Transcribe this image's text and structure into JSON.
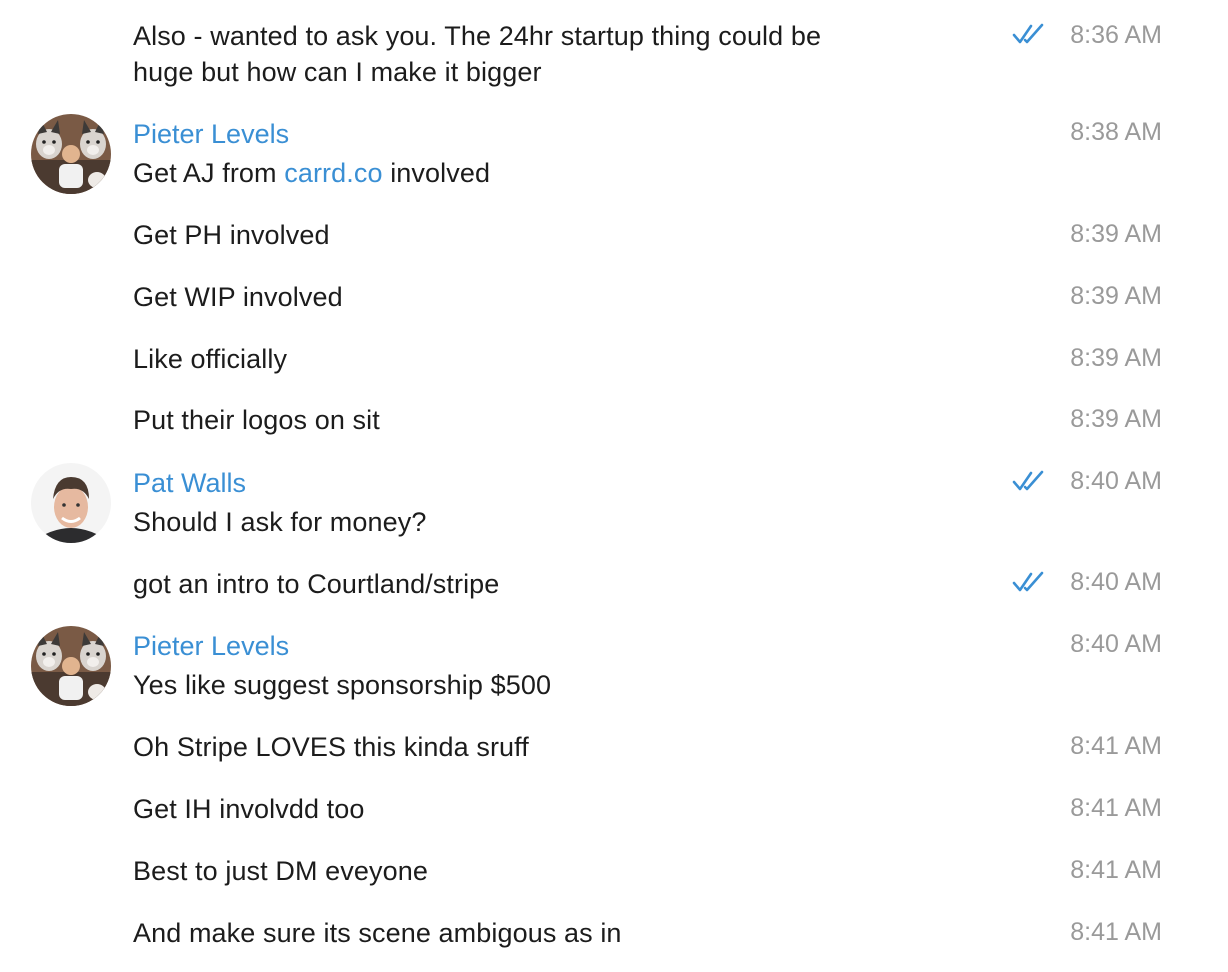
{
  "messages": [
    {
      "id": "m1",
      "text_line1": "Also - wanted to ask you. The 24hr startup thing could be",
      "text_line2": "huge but how can I make it bigger",
      "time": "8:36 AM",
      "read": true
    },
    {
      "id": "m2",
      "sender": "Pieter Levels",
      "text_pre": "Get AJ from ",
      "link": "carrd.co",
      "text_post": " involved",
      "time": "8:38 AM"
    },
    {
      "id": "m3",
      "text": "Get PH involved",
      "time": "8:39 AM"
    },
    {
      "id": "m4",
      "text": "Get WIP involved",
      "time": "8:39 AM"
    },
    {
      "id": "m5",
      "text": "Like officially",
      "time": "8:39 AM"
    },
    {
      "id": "m6",
      "text": "Put their logos on sit",
      "time": "8:39 AM"
    },
    {
      "id": "m7",
      "sender": "Pat Walls",
      "text": "Should I ask for money?",
      "time": "8:40 AM",
      "read": true
    },
    {
      "id": "m8",
      "text": "got an intro to Courtland/stripe",
      "time": "8:40 AM",
      "read": true
    },
    {
      "id": "m9",
      "sender": "Pieter Levels",
      "text": "Yes like suggest sponsorship $500",
      "time": "8:40 AM"
    },
    {
      "id": "m10",
      "text": "Oh Stripe LOVES this kinda sruff",
      "time": "8:41 AM"
    },
    {
      "id": "m11",
      "text": "Get IH involvdd too",
      "time": "8:41 AM"
    },
    {
      "id": "m12",
      "text": "Best to just DM eveyone",
      "time": "8:41 AM"
    },
    {
      "id": "m13",
      "text": "And make sure its scene ambigous as in",
      "time": "8:41 AM"
    }
  ],
  "colors": {
    "link": "#3a8fd4",
    "sender": "#3a8fd4",
    "time": "#9a9a9a",
    "check": "#3a8fd4"
  },
  "icons": {
    "read_receipt": "double-check-icon"
  }
}
